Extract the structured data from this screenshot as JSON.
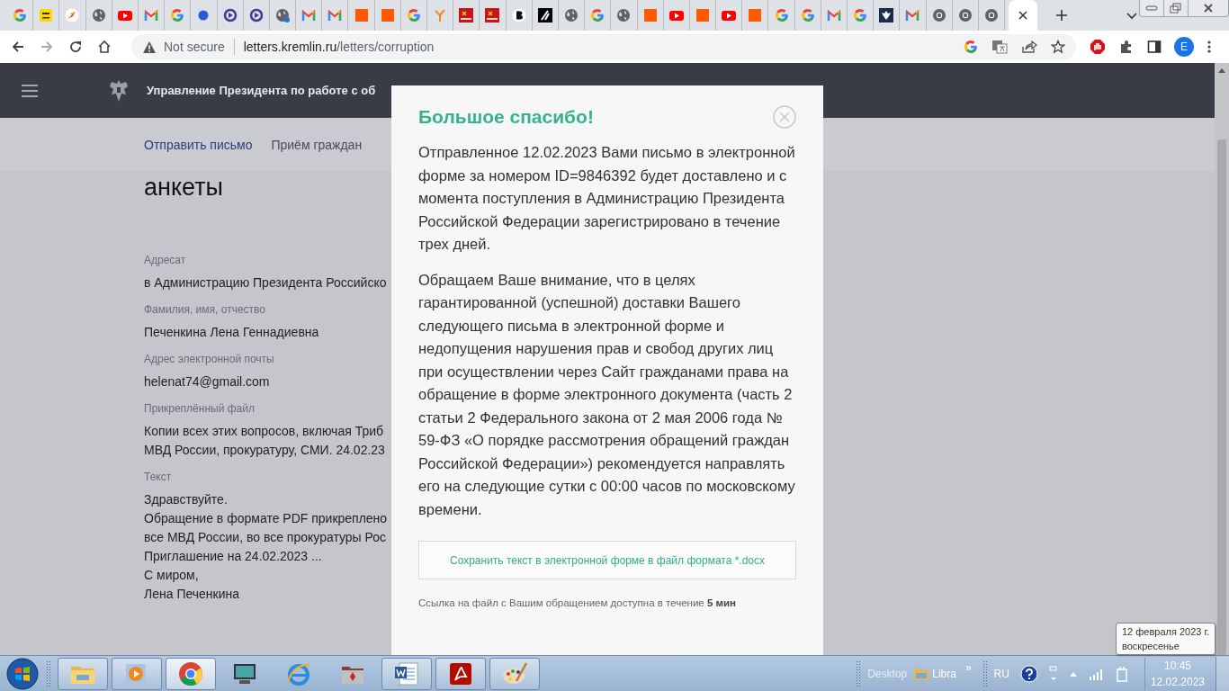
{
  "browser": {
    "tabs": [
      {
        "kind": "google",
        "selected": false
      },
      {
        "kind": "ua",
        "selected": false
      },
      {
        "kind": "swift",
        "selected": false
      },
      {
        "kind": "globe",
        "selected": false
      },
      {
        "kind": "youtube",
        "selected": false
      },
      {
        "kind": "gmail",
        "selected": false
      },
      {
        "kind": "google",
        "selected": false
      },
      {
        "kind": "dot",
        "selected": false
      },
      {
        "kind": "play-circle",
        "selected": false
      },
      {
        "kind": "play-circle",
        "selected": false
      },
      {
        "kind": "globe-dot",
        "selected": false
      },
      {
        "kind": "gmail",
        "selected": false
      },
      {
        "kind": "gmail",
        "selected": false
      },
      {
        "kind": "orange",
        "selected": false
      },
      {
        "kind": "orange",
        "selected": false
      },
      {
        "kind": "google",
        "selected": false
      },
      {
        "kind": "fork",
        "selected": false
      },
      {
        "kind": "red-flag",
        "selected": false
      },
      {
        "kind": "red-flag",
        "selected": false
      },
      {
        "kind": "letter-b",
        "selected": false
      },
      {
        "kind": "letter-a",
        "selected": false
      },
      {
        "kind": "globe",
        "selected": false
      },
      {
        "kind": "google",
        "selected": false
      },
      {
        "kind": "globe",
        "selected": false
      },
      {
        "kind": "orange",
        "selected": false
      },
      {
        "kind": "youtube",
        "selected": false
      },
      {
        "kind": "orange",
        "selected": false
      },
      {
        "kind": "youtube",
        "selected": false
      },
      {
        "kind": "orange",
        "selected": false
      },
      {
        "kind": "google",
        "selected": false
      },
      {
        "kind": "google",
        "selected": false
      },
      {
        "kind": "gmail",
        "selected": false
      },
      {
        "kind": "google",
        "selected": false
      },
      {
        "kind": "emblem",
        "selected": false
      },
      {
        "kind": "gmail",
        "selected": false
      },
      {
        "kind": "chrome",
        "selected": false
      },
      {
        "kind": "chrome",
        "selected": false
      },
      {
        "kind": "chrome",
        "selected": false
      },
      {
        "kind": "none",
        "selected": true
      }
    ],
    "address_bar": {
      "security": "Not secure",
      "host": "letters.kremlin.ru",
      "path": "/letters/corruption"
    },
    "profile_initial": "E"
  },
  "site_header": {
    "title": "Управление Президента по работе с об"
  },
  "nav": [
    {
      "label": "Отправить письмо",
      "selected": true
    },
    {
      "label": "Приём граждан",
      "selected": false
    }
  ],
  "heading": "анкеты",
  "fields": [
    {
      "label": "Адресат",
      "lines": [
        "в Администрацию Президента Российско"
      ]
    },
    {
      "label": "Фамилия, имя, отчество",
      "lines": [
        "Печенкина Лена Геннадиевна"
      ]
    },
    {
      "label": "Адрес электронной почты",
      "lines": [
        "helenat74@gmail.com"
      ]
    },
    {
      "label": "Прикреплённый файл",
      "lines": [
        "Копии всех этих вопросов, включая Триб",
        "МВД России, прокуратуру, СМИ. 24.02.23"
      ]
    },
    {
      "label": "Текст",
      "lines": [
        "Здравствуйте.",
        "Обращение в формате PDF прикреплено",
        "все МВД России, во все прокуратуры Рос",
        "Приглашение на 24.02.2023 ...",
        "С миром,",
        "Лена Печенкина"
      ]
    }
  ],
  "dialog": {
    "title": "Большое спасибо!",
    "paragraphs": [
      "Отправленное 12.02.2023 Вами письмо в электронной форме за номером ID=9846392 будет доставлено и с момента поступления в Администрацию Президента Российской Федерации зарегистрировано в течение трех дней.",
      "Обращаем Ваше внимание, что в целях гарантированной (успешной) доставки Вашего следующего письма в электронной форме и недопущения нарушения прав и свобод других лиц при осуществлении через Сайт гражданами права на обращение в форме электронного документа (часть 2 статьи 2 Федерального закона от 2 мая 2006 года № 59-ФЗ «О порядке рассмотрения обращений граждан Российской Федерации») рекомендуется направлять его на следующие сутки с 00:00 часов по московскому времени."
    ],
    "save_button": "Сохранить текст в электронной форме в файл формата *.docx",
    "note": "Ссылка на файл с Вашим обращением доступна в течение **5 мин**"
  },
  "taskbar": {
    "apps": [
      {
        "kind": "explorer",
        "running": true,
        "selected": false
      },
      {
        "kind": "media",
        "running": true,
        "selected": false
      },
      {
        "kind": "chrome",
        "running": true,
        "selected": true
      },
      {
        "kind": "monitor",
        "running": false,
        "selected": false
      },
      {
        "kind": "ie",
        "running": false,
        "selected": false
      },
      {
        "kind": "folder",
        "running": false,
        "selected": false
      },
      {
        "kind": "word",
        "running": true,
        "selected": false
      },
      {
        "kind": "pdf",
        "running": true,
        "selected": false
      },
      {
        "kind": "paint",
        "running": true,
        "selected": false
      }
    ],
    "toolbars": [
      "Desktop",
      "Libra"
    ],
    "more": "»",
    "language": "RU",
    "time": "10:45",
    "date": "12.02.2023"
  },
  "tooltip": {
    "lines": [
      "12 февраля 2023 г.",
      "воскресенье"
    ]
  }
}
